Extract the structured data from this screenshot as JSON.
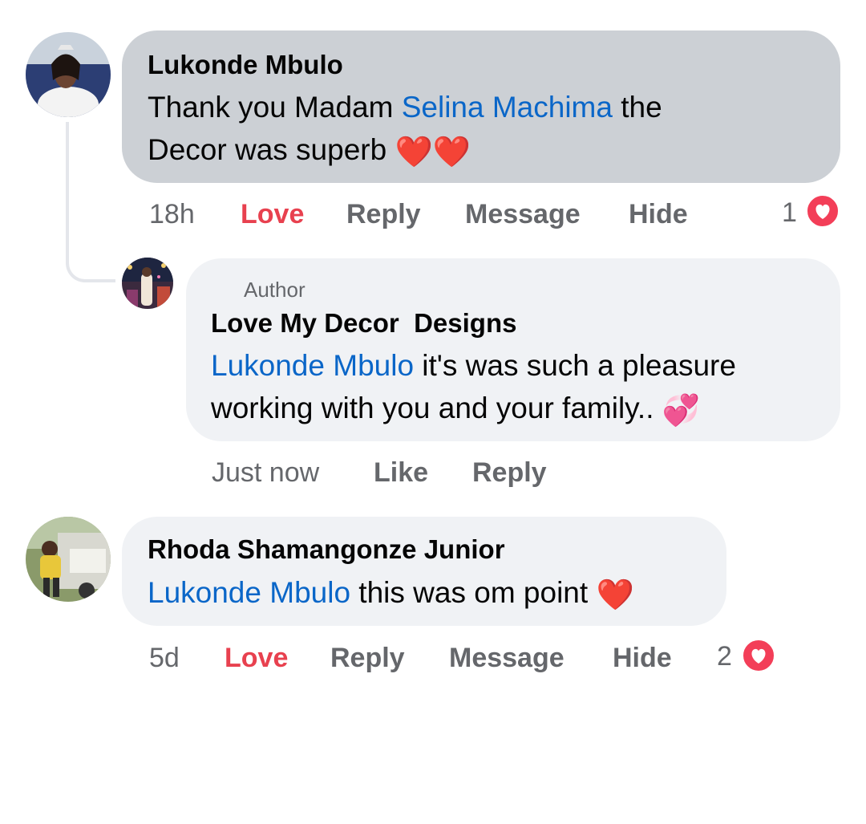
{
  "comments": [
    {
      "author": "Lukonde Mbulo",
      "text_before": "Thank you Madam ",
      "mention": "Selina Machima",
      "text_after": " the",
      "text_line2": "Decor was superb ",
      "emoji": "❤️❤️",
      "time": "18h",
      "actions": {
        "love": "Love",
        "reply": "Reply",
        "message": "Message",
        "hide": "Hide"
      },
      "reaction_count": "1",
      "reaction_icon": "heart-reaction-icon",
      "replies": [
        {
          "badge": "Author",
          "author": "Love My Decor  Designs",
          "mention": "Lukonde Mbulo",
          "text_line1": " it's was such a pleasure",
          "text_line2": "working with you and your family.. ",
          "emoji": "💞",
          "time": "Just now",
          "actions": {
            "like": "Like",
            "reply": "Reply"
          }
        }
      ]
    },
    {
      "author": "Rhoda Shamangonze Junior",
      "mention": "Lukonde Mbulo",
      "text": " this was om point ",
      "emoji": "❤️",
      "time": "5d",
      "actions": {
        "love": "Love",
        "reply": "Reply",
        "message": "Message",
        "hide": "Hide"
      },
      "reaction_count": "2",
      "reaction_icon": "heart-reaction-icon"
    }
  ],
  "colors": {
    "mention": "#0a66c8",
    "love_active": "#e8414f",
    "secondary_text": "#65676b",
    "bubble_grey": "#ccd0d5",
    "bubble_light": "#f0f2f5"
  }
}
